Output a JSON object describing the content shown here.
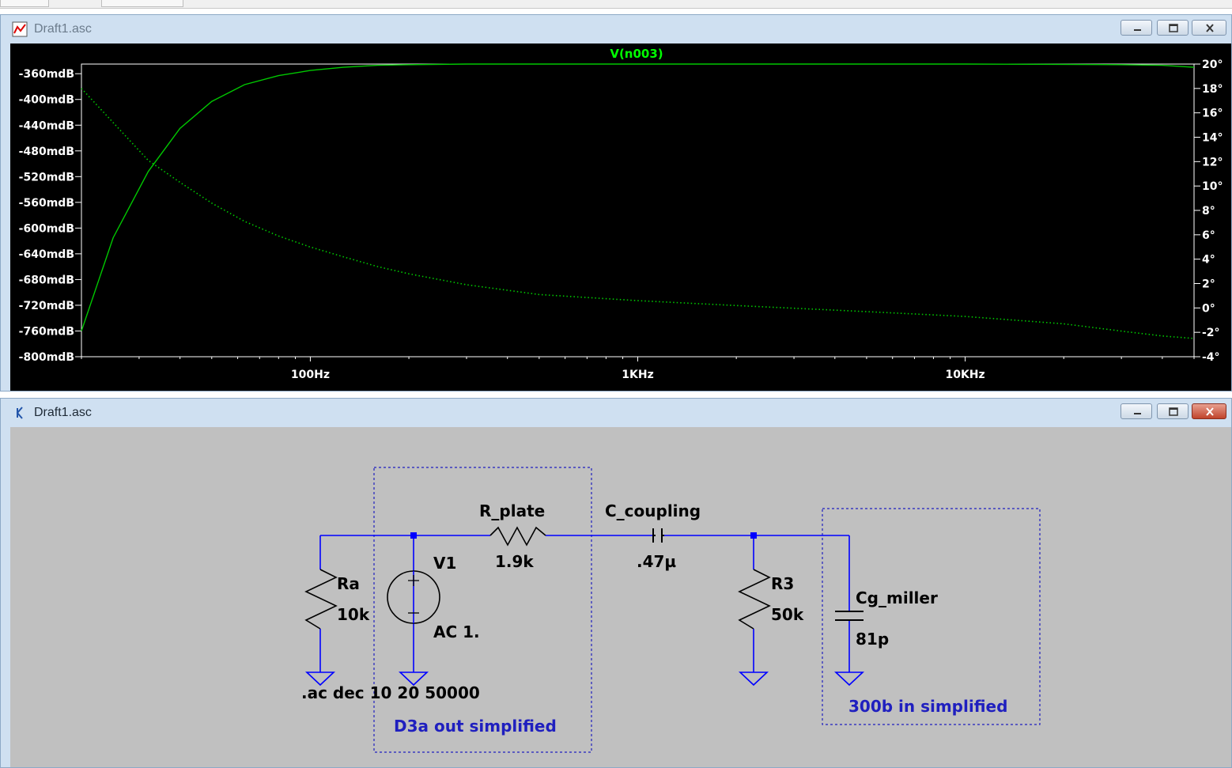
{
  "plot_window": {
    "title": "Draft1.asc",
    "trace_label": "V(n003)"
  },
  "schematic_window": {
    "title": "Draft1.asc",
    "components": {
      "ra_name": "Ra",
      "ra_value": "10k",
      "v1_name": "V1",
      "v1_value": "AC 1.",
      "rplate_name": "R_plate",
      "rplate_value": "1.9k",
      "ccoupling_name": "C_coupling",
      "ccoupling_value": ".47µ",
      "r3_name": "R3",
      "r3_value": "50k",
      "cg_name": "Cg_miller",
      "cg_value": "81p"
    },
    "directive": ".ac dec 10 20 50000",
    "comments": {
      "d3a": "D3a out simplified",
      "b300": "300b in simplified"
    },
    "colors": {
      "wire": "#0000ff",
      "comment": "#1f1fbf",
      "trace": "#00c800"
    }
  },
  "chart_data": {
    "type": "line",
    "title": "V(n003)",
    "xscale": "log",
    "xlim": [
      20,
      50000
    ],
    "x_ticks": [
      "100Hz",
      "1KHz",
      "10KHz"
    ],
    "ylim": [
      -800,
      -345
    ],
    "yticks": [
      "-360mdB",
      "-400mdB",
      "-440mdB",
      "-480mdB",
      "-520mdB",
      "-560mdB",
      "-600mdB",
      "-640mdB",
      "-680mdB",
      "-720mdB",
      "-760mdB",
      "-800mdB"
    ],
    "y2lim": [
      -4,
      20
    ],
    "y2ticks": [
      "20°",
      "18°",
      "16°",
      "14°",
      "12°",
      "10°",
      "8°",
      "6°",
      "4°",
      "2°",
      "0°",
      "-2°",
      "-4°"
    ],
    "series": [
      {
        "style": "solid",
        "axis": "left",
        "x": [
          20,
          25,
          32,
          40,
          50,
          63,
          80,
          100,
          126,
          160,
          200,
          300,
          500,
          1000,
          2000,
          5000,
          10000,
          20000,
          30000,
          40000,
          50000
        ],
        "y": [
          -760,
          -615,
          -512,
          -445,
          -403,
          -377,
          -363,
          -355,
          -350,
          -347,
          -346,
          -345,
          -345,
          -345,
          -345,
          -345,
          -345,
          -345.5,
          -346,
          -347,
          -350
        ]
      },
      {
        "style": "dotted",
        "axis": "right",
        "x": [
          20,
          25,
          32,
          40,
          50,
          63,
          80,
          100,
          126,
          160,
          200,
          300,
          500,
          1000,
          2000,
          5000,
          10000,
          20000,
          30000,
          40000,
          50000
        ],
        "y": [
          18.0,
          15.2,
          12.1,
          10.3,
          8.6,
          7.1,
          5.9,
          5.0,
          4.2,
          3.4,
          2.8,
          1.9,
          1.1,
          0.6,
          0.2,
          -0.3,
          -0.7,
          -1.3,
          -1.9,
          -2.3,
          -2.5
        ]
      }
    ]
  }
}
